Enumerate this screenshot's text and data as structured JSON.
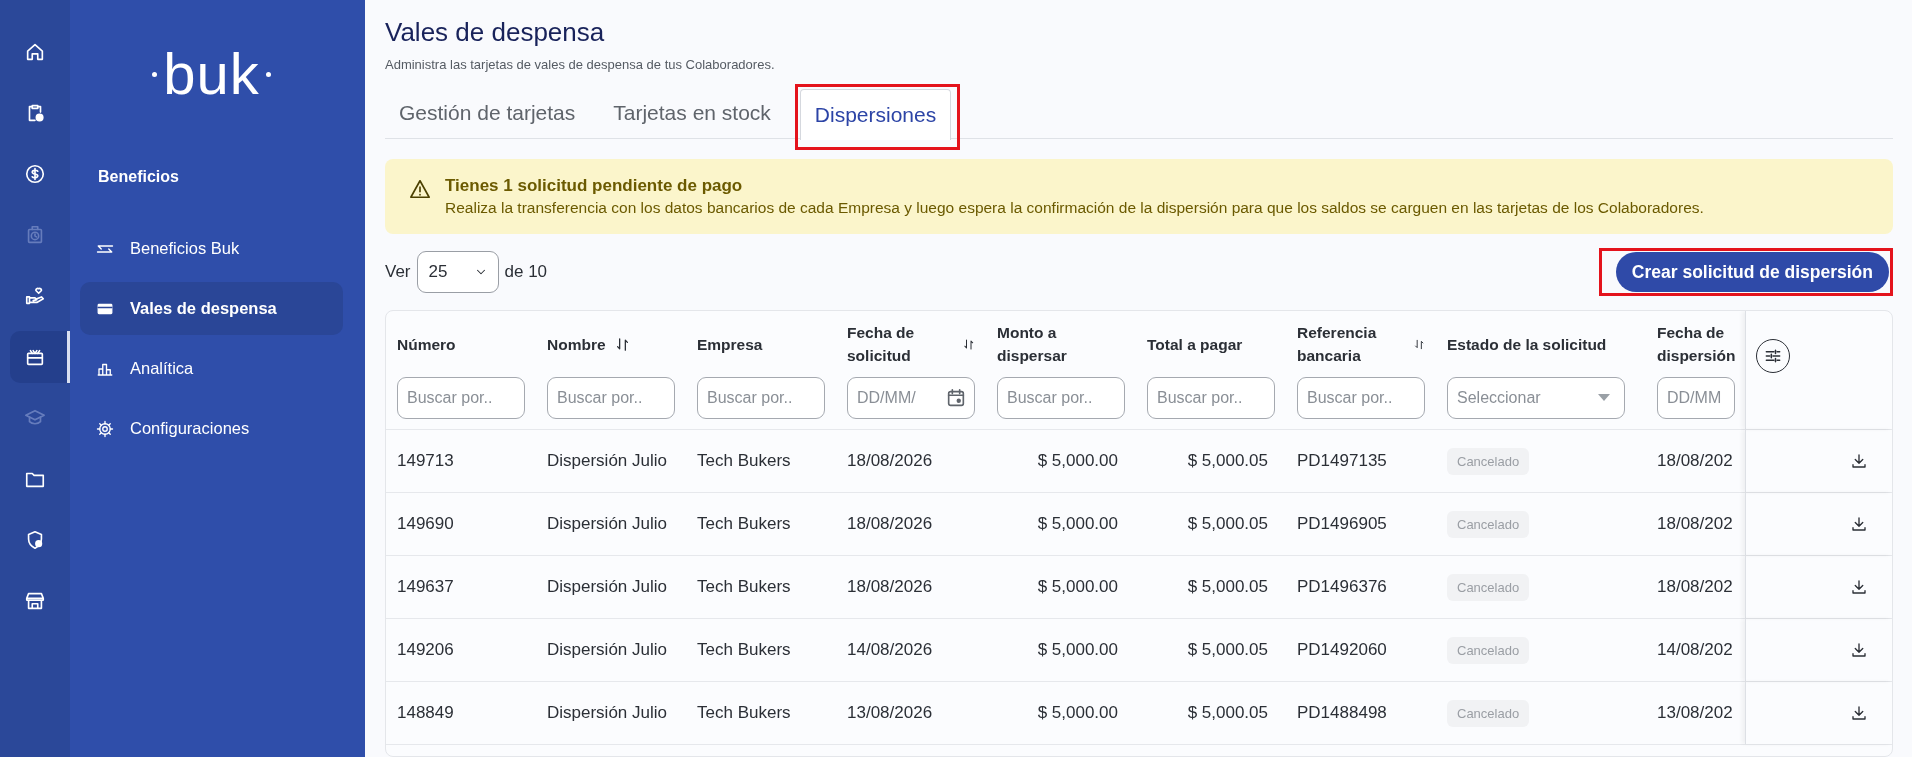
{
  "rail": {
    "items": [
      {
        "selected": false,
        "disabled": false
      },
      {
        "selected": false,
        "disabled": false
      },
      {
        "selected": false,
        "disabled": false
      },
      {
        "selected": false,
        "disabled": true
      },
      {
        "selected": false,
        "disabled": false
      },
      {
        "selected": true,
        "disabled": false
      },
      {
        "selected": false,
        "disabled": true
      },
      {
        "selected": false,
        "disabled": false
      },
      {
        "selected": false,
        "disabled": false
      },
      {
        "selected": false,
        "disabled": false
      }
    ]
  },
  "sidebar": {
    "logo": "buk",
    "section_title": "Beneficios",
    "items": [
      {
        "label": "Beneficios Buk",
        "selected": false
      },
      {
        "label": "Vales de despensa",
        "selected": true
      },
      {
        "label": "Analítica",
        "selected": false
      },
      {
        "label": "Configuraciones",
        "selected": false
      }
    ]
  },
  "page": {
    "title": "Vales de despensa",
    "subtitle": "Administra las tarjetas de vales de despensa de tus Colaboradores."
  },
  "tabs": [
    {
      "label": "Gestión de tarjetas",
      "selected": false,
      "highlighted": false
    },
    {
      "label": "Tarjetas en stock",
      "selected": false,
      "highlighted": false
    },
    {
      "label": "Dispersiones",
      "selected": true,
      "highlighted": true
    }
  ],
  "alert": {
    "title": "Tienes 1 solicitud pendiente de pago",
    "message": "Realiza la transferencia con los datos bancarios de cada Empresa y luego espera la confirmación de la dispersión para que los saldos se carguen en las tarjetas de los Colaboradores."
  },
  "pagination": {
    "prefix": "Ver",
    "page_size": "25",
    "suffix": "de 10"
  },
  "create_button": {
    "label": "Crear solicitud de dispersión",
    "highlighted": true
  },
  "table": {
    "columns": [
      {
        "label": "Número",
        "kind": "text",
        "sortable": false,
        "filter": {
          "kind": "text",
          "placeholder": "Buscar por.."
        }
      },
      {
        "label": "Nombre",
        "kind": "text",
        "sortable": true,
        "filter": {
          "kind": "text",
          "placeholder": "Buscar por.."
        }
      },
      {
        "label": "Empresa",
        "kind": "text",
        "sortable": false,
        "filter": {
          "kind": "text",
          "placeholder": "Buscar por.."
        }
      },
      {
        "label": "Fecha de solicitud",
        "kind": "text",
        "sortable": true,
        "filter": {
          "kind": "date",
          "placeholder": "DD/MM/"
        }
      },
      {
        "label": "Monto a dispersar",
        "kind": "amount",
        "sortable": false,
        "filter": {
          "kind": "text",
          "placeholder": "Buscar por.."
        }
      },
      {
        "label": "Total a pagar",
        "kind": "amount",
        "sortable": false,
        "filter": {
          "kind": "text",
          "placeholder": "Buscar por.."
        }
      },
      {
        "label": "Referencia bancaria",
        "kind": "text",
        "sortable": true,
        "filter": {
          "kind": "text",
          "placeholder": "Buscar por.."
        }
      },
      {
        "label": "Estado de la solicitud",
        "kind": "badge",
        "sortable": false,
        "filter": {
          "kind": "select",
          "placeholder": "Seleccionar"
        }
      },
      {
        "label": "Fecha de dispersión",
        "kind": "text",
        "sortable": false,
        "filter": {
          "kind": "date_cut",
          "placeholder": "DD/MM"
        }
      }
    ],
    "rows": [
      {
        "cells": [
          "149713",
          "Dispersión Julio",
          "Tech Bukers",
          "18/08/2026",
          "$ 5,000.00",
          "$ 5,000.05",
          "PD1497135",
          "Cancelado",
          "18/08/202"
        ]
      },
      {
        "cells": [
          "149690",
          "Dispersión Julio",
          "Tech Bukers",
          "18/08/2026",
          "$ 5,000.00",
          "$ 5,000.05",
          "PD1496905",
          "Cancelado",
          "18/08/202"
        ]
      },
      {
        "cells": [
          "149637",
          "Dispersión Julio",
          "Tech Bukers",
          "18/08/2026",
          "$ 5,000.00",
          "$ 5,000.05",
          "PD1496376",
          "Cancelado",
          "18/08/202"
        ]
      },
      {
        "cells": [
          "149206",
          "Dispersión Julio",
          "Tech Bukers",
          "14/08/2026",
          "$ 5,000.00",
          "$ 5,000.05",
          "PD1492060",
          "Cancelado",
          "14/08/202"
        ]
      },
      {
        "cells": [
          "148849",
          "Dispersión Julio",
          "Tech Bukers",
          "13/08/2026",
          "$ 5,000.00",
          "$ 5,000.05",
          "PD1488498",
          "Cancelado",
          "13/08/202"
        ]
      }
    ]
  }
}
